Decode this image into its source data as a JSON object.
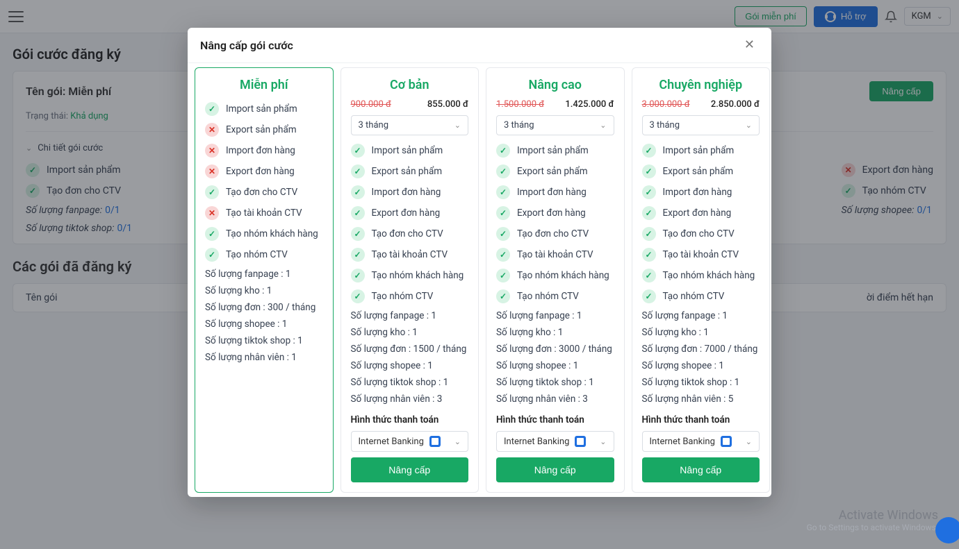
{
  "topbar": {
    "free_plan_label": "Gói miễn phí",
    "support_label": "Hỗ trợ",
    "user_label": "KGM"
  },
  "page": {
    "title": "Gói cước đăng ký",
    "pkg_name_label": "Tên gói:",
    "pkg_name_value": "Miễn phí",
    "upgrade_label": "Nâng cấp",
    "status_label": "Trạng thái:",
    "status_value": "Khả dụng",
    "detail_label": "Chi tiết gói cước",
    "bg_feats": {
      "col1": [
        {
          "ok": true,
          "t": "Import sản phẩm"
        },
        {
          "ok": true,
          "t": "Tạo đơn cho CTV"
        }
      ],
      "col2": [
        {
          "ok": false,
          "t": "Export đơn hàng"
        },
        {
          "ok": true,
          "t": "Tạo nhóm CTV"
        }
      ]
    },
    "qty": {
      "fanpage": {
        "label": "Số lượng fanpage:",
        "val": "0/1"
      },
      "tiktok": {
        "label": "Số lượng tiktok shop:",
        "val": "0/1"
      },
      "shopee": {
        "label": "Số lượng shopee:",
        "val": "0/1"
      }
    },
    "section2_title": "Các gói đã đăng ký",
    "table_head": {
      "c1": "Tên gói",
      "c2": "ời điểm hết hạn"
    }
  },
  "modal": {
    "title": "Nâng cấp gói cước",
    "duration_label": "3 tháng",
    "pay_title": "Hình thức thanh toán",
    "pay_option": "Internet Banking",
    "upgrade_btn": "Nâng cấp",
    "free": {
      "name": "Miễn phí",
      "features": [
        {
          "ok": true,
          "t": "Import sản phẩm"
        },
        {
          "ok": false,
          "t": "Export sản phẩm"
        },
        {
          "ok": false,
          "t": "Import đơn hàng"
        },
        {
          "ok": false,
          "t": "Export đơn hàng"
        },
        {
          "ok": true,
          "t": "Tạo đơn cho CTV"
        },
        {
          "ok": false,
          "t": "Tạo tài khoản CTV"
        },
        {
          "ok": true,
          "t": "Tạo nhóm khách hàng"
        },
        {
          "ok": true,
          "t": "Tạo nhóm CTV"
        }
      ],
      "quotas": [
        "Số lượng fanpage : 1",
        "Số lượng kho : 1",
        "Số lượng đơn : 300 / tháng",
        "Số lượng shopee : 1",
        "Số lượng tiktok shop : 1",
        "Số lượng nhân viên : 1"
      ]
    },
    "basic": {
      "name": "Cơ bản",
      "old": "900.000 đ",
      "new": "855.000 đ",
      "features": [
        {
          "ok": true,
          "t": "Import sản phẩm"
        },
        {
          "ok": true,
          "t": "Export sản phẩm"
        },
        {
          "ok": true,
          "t": "Import đơn hàng"
        },
        {
          "ok": true,
          "t": "Export đơn hàng"
        },
        {
          "ok": true,
          "t": "Tạo đơn cho CTV"
        },
        {
          "ok": true,
          "t": "Tạo tài khoản CTV"
        },
        {
          "ok": true,
          "t": "Tạo nhóm khách hàng"
        },
        {
          "ok": true,
          "t": "Tạo nhóm CTV"
        }
      ],
      "quotas": [
        "Số lượng fanpage : 1",
        "Số lượng kho : 1",
        "Số lượng đơn : 1500 / tháng",
        "Số lượng shopee : 1",
        "Số lượng tiktok shop : 1",
        "Số lượng nhân viên : 3"
      ]
    },
    "adv": {
      "name": "Nâng cao",
      "old": "1.500.000 đ",
      "new": "1.425.000 đ",
      "features": [
        {
          "ok": true,
          "t": "Import sản phẩm"
        },
        {
          "ok": true,
          "t": "Export sản phẩm"
        },
        {
          "ok": true,
          "t": "Import đơn hàng"
        },
        {
          "ok": true,
          "t": "Export đơn hàng"
        },
        {
          "ok": true,
          "t": "Tạo đơn cho CTV"
        },
        {
          "ok": true,
          "t": "Tạo tài khoản CTV"
        },
        {
          "ok": true,
          "t": "Tạo nhóm khách hàng"
        },
        {
          "ok": true,
          "t": "Tạo nhóm CTV"
        }
      ],
      "quotas": [
        "Số lượng fanpage : 1",
        "Số lượng kho : 1",
        "Số lượng đơn : 3000 / tháng",
        "Số lượng shopee : 1",
        "Số lượng tiktok shop : 1",
        "Số lượng nhân viên : 3"
      ]
    },
    "pro": {
      "name": "Chuyên nghiệp",
      "old": "3.000.000 đ",
      "new": "2.850.000 đ",
      "features": [
        {
          "ok": true,
          "t": "Import sản phẩm"
        },
        {
          "ok": true,
          "t": "Export sản phẩm"
        },
        {
          "ok": true,
          "t": "Import đơn hàng"
        },
        {
          "ok": true,
          "t": "Export đơn hàng"
        },
        {
          "ok": true,
          "t": "Tạo đơn cho CTV"
        },
        {
          "ok": true,
          "t": "Tạo tài khoản CTV"
        },
        {
          "ok": true,
          "t": "Tạo nhóm khách hàng"
        },
        {
          "ok": true,
          "t": "Tạo nhóm CTV"
        }
      ],
      "quotas": [
        "Số lượng fanpage : 1",
        "Số lượng kho : 1",
        "Số lượng đơn : 7000 / tháng",
        "Số lượng shopee : 1",
        "Số lượng tiktok shop : 1",
        "Số lượng nhân viên : 5"
      ]
    }
  },
  "wm": {
    "l1": "Activate Windows",
    "l2": "Go to Settings to activate Windows."
  }
}
